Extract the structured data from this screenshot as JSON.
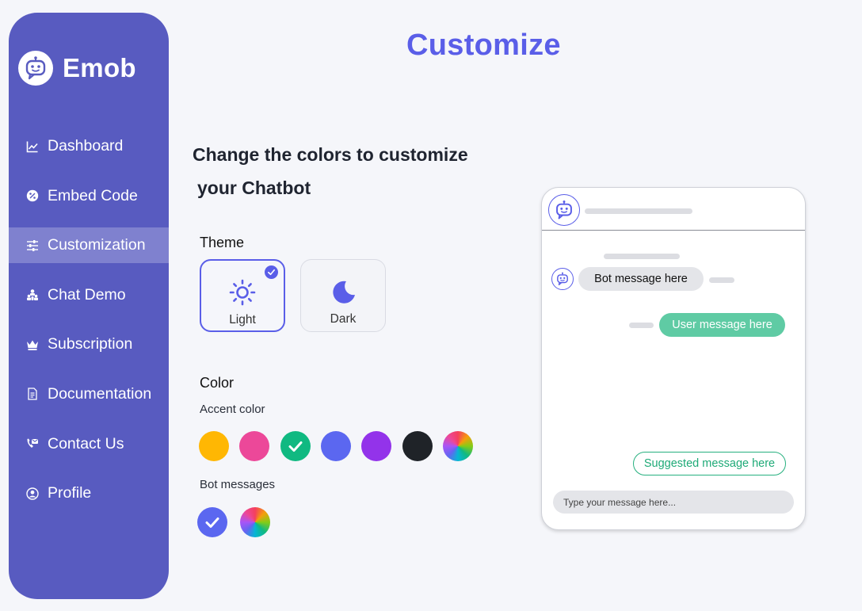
{
  "brand": {
    "name": "Emob",
    "icon": "robot-chat-icon"
  },
  "sidebar": {
    "items": [
      {
        "label": "Dashboard",
        "icon": "line-chart-icon",
        "active": false
      },
      {
        "label": "Embed Code",
        "icon": "percent-badge-icon",
        "active": false
      },
      {
        "label": "Customization",
        "icon": "sliders-icon",
        "active": true
      },
      {
        "label": "Chat Demo",
        "icon": "people-icon",
        "active": false
      },
      {
        "label": "Subscription",
        "icon": "crown-icon",
        "active": false
      },
      {
        "label": "Documentation",
        "icon": "document-icon",
        "active": false
      },
      {
        "label": "Contact Us",
        "icon": "phone-mail-icon",
        "active": false
      },
      {
        "label": "Profile",
        "icon": "user-circle-icon",
        "active": false
      }
    ]
  },
  "main": {
    "title": "Customize",
    "headline_line1": "Change the colors to customize",
    "headline_line2": "your Chatbot",
    "theme": {
      "label": "Theme",
      "options": [
        {
          "label": "Light",
          "icon": "sun-icon",
          "selected": true
        },
        {
          "label": "Dark",
          "icon": "moon-icon",
          "selected": false
        }
      ]
    },
    "color": {
      "label": "Color",
      "accent_label": "Accent color",
      "accent_swatches": [
        "#ffb703",
        "#ec4899",
        "#10b981",
        "#5b67f0",
        "#9333ea",
        "#1f2328",
        "multicolor"
      ],
      "accent_selected": "#10b981",
      "bot_label": "Bot messages",
      "bot_swatches": [
        "#5b67f0",
        "multicolor"
      ],
      "bot_selected": "#5b67f0"
    }
  },
  "preview": {
    "bot_message": "Bot message here",
    "user_message": "User message here",
    "suggested_message": "Suggested message here",
    "input_placeholder": "Type your message here..."
  }
}
